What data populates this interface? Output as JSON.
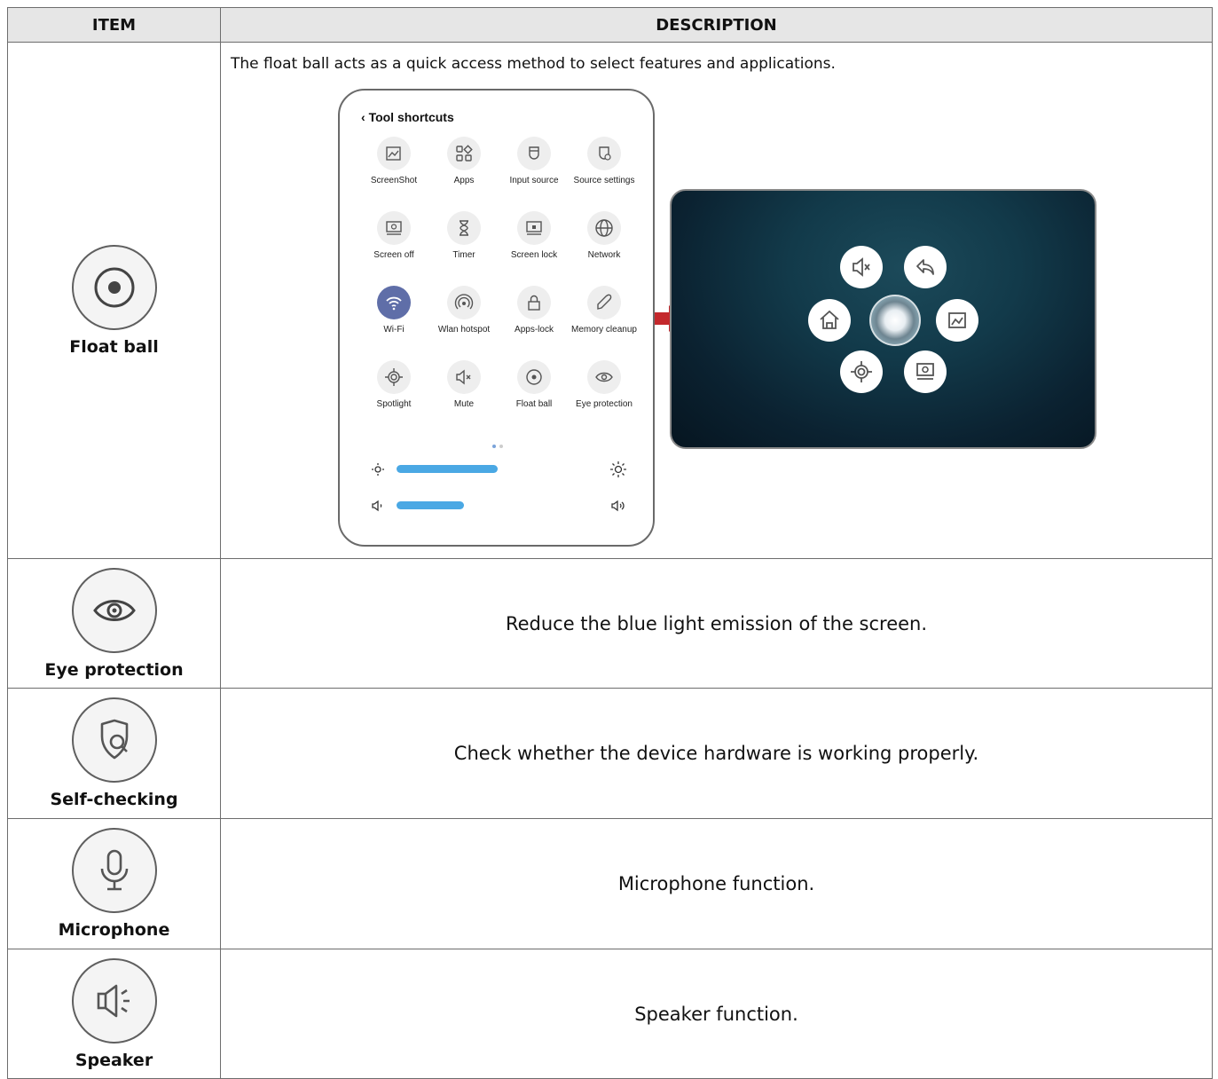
{
  "header": {
    "item": "ITEM",
    "description": "DESCRIPTION"
  },
  "float_ball": {
    "name": "Float ball",
    "icon": "float-ball-icon",
    "description": "The float ball acts as a quick access method to select features and applications.",
    "panel": {
      "title": "Tool shortcuts",
      "tiles": [
        {
          "label": "ScreenShot",
          "icon": "screenshot-icon"
        },
        {
          "label": "Apps",
          "icon": "apps-icon"
        },
        {
          "label": "Input source",
          "icon": "input-source-icon"
        },
        {
          "label": "Source settings",
          "icon": "source-settings-icon"
        },
        {
          "label": "Screen off",
          "icon": "screen-off-icon"
        },
        {
          "label": "Timer",
          "icon": "timer-icon"
        },
        {
          "label": "Screen lock",
          "icon": "screen-lock-icon"
        },
        {
          "label": "Network",
          "icon": "network-icon"
        },
        {
          "label": "Wi-Fi",
          "icon": "wifi-icon"
        },
        {
          "label": "Wlan hotspot",
          "icon": "hotspot-icon"
        },
        {
          "label": "Apps-lock",
          "icon": "apps-lock-icon"
        },
        {
          "label": "Memory cleanup",
          "icon": "memory-cleanup-icon"
        },
        {
          "label": "Spotlight",
          "icon": "spotlight-icon"
        },
        {
          "label": "Mute",
          "icon": "mute-icon"
        },
        {
          "label": "Float ball",
          "icon": "float-ball-icon"
        },
        {
          "label": "Eye protection",
          "icon": "eye-icon"
        }
      ],
      "brightness_level": 0.75,
      "volume_level": 0.5
    }
  },
  "rows": [
    {
      "name": "Eye protection",
      "icon": "eye-icon",
      "description": "Reduce the blue light emission of the screen."
    },
    {
      "name": "Self-checking",
      "icon": "shield-search-icon",
      "description": "Check whether the device hardware is working properly."
    },
    {
      "name": "Microphone",
      "icon": "microphone-icon",
      "description": "Microphone function."
    },
    {
      "name": "Speaker",
      "icon": "speaker-icon",
      "description": "Speaker function."
    }
  ]
}
